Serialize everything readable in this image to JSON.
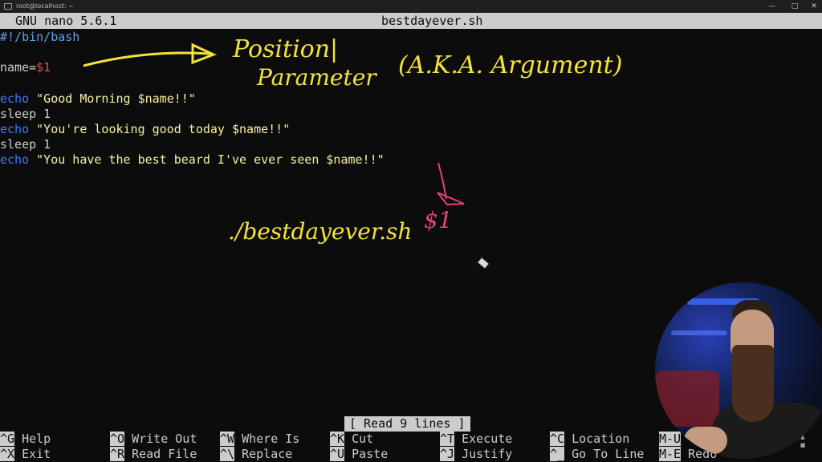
{
  "window": {
    "title": "root@localhost: ~"
  },
  "nano": {
    "version": "GNU nano 5.6.1",
    "filename": "bestdayever.sh"
  },
  "code": {
    "shebang": "#!/bin/bash",
    "assign_var": "name=",
    "assign_val": "$1",
    "echo1_kw": "echo",
    "echo1_str": " \"Good Morning $name!!\"",
    "sleep1": "sleep 1",
    "echo2_kw": "echo",
    "echo2_str": " \"You're looking good today $name!!\"",
    "sleep2": "sleep 1",
    "echo3_kw": "echo",
    "echo3_str": " \"You have the best beard I've ever seen $name!!\""
  },
  "annotations": {
    "positional_1": "Position|",
    "positional_2": "Parameter",
    "aka": "(A.K.A. Argument)",
    "command": "./bestdayever.sh",
    "arg": "$1"
  },
  "status": "[ Read 9 lines ]",
  "shortcuts": [
    {
      "key": "^G",
      "label": "Help"
    },
    {
      "key": "^X",
      "label": "Exit"
    },
    {
      "key": "^O",
      "label": "Write Out"
    },
    {
      "key": "^R",
      "label": "Read File"
    },
    {
      "key": "^W",
      "label": "Where Is"
    },
    {
      "key": "^\\",
      "label": "Replace"
    },
    {
      "key": "^K",
      "label": "Cut"
    },
    {
      "key": "^U",
      "label": "Paste"
    },
    {
      "key": "^T",
      "label": "Execute"
    },
    {
      "key": "^J",
      "label": "Justify"
    },
    {
      "key": "^C",
      "label": "Location"
    },
    {
      "key": "^_",
      "label": "Go To Line"
    },
    {
      "key": "M-U",
      "label": ""
    },
    {
      "key": "M-E",
      "label": "Redo"
    }
  ],
  "colors": {
    "keyword": "#3b78ff",
    "variable": "#e74856",
    "string": "#f9f1a5",
    "annotation_yellow": "#f3e33b",
    "annotation_pink": "#e8407f"
  },
  "icons": {
    "terminal": "terminal-icon",
    "minimize": "minimize-icon",
    "maximize": "maximize-icon",
    "close": "close-icon",
    "cursor": "cursor-icon"
  }
}
